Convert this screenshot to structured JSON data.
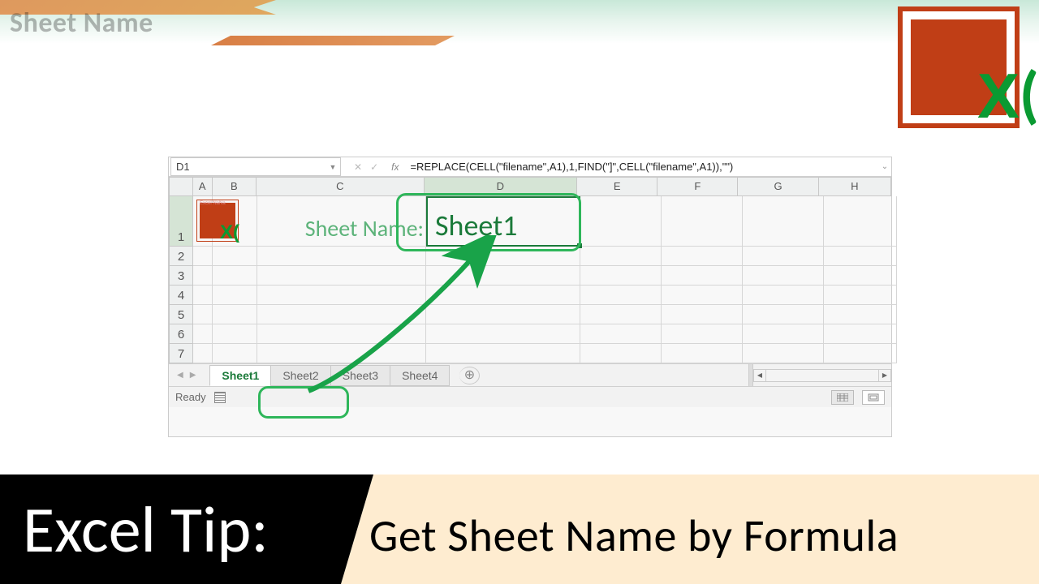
{
  "header": {
    "title": "Sheet Name"
  },
  "logo": {
    "glyph_x": "X",
    "glyph_paren": "("
  },
  "excel": {
    "name_box": "D1",
    "fx_label": "fx",
    "formula": "=REPLACE(CELL(\"filename\",A1),1,FIND(\"]\",CELL(\"filename\",A1)),\"\")",
    "columns": [
      "A",
      "B",
      "C",
      "D",
      "E",
      "F",
      "G",
      "H"
    ],
    "rows": [
      "1",
      "2",
      "3",
      "4",
      "5",
      "6",
      "7"
    ],
    "label_c1": "Sheet Name:",
    "value_d1": "Sheet1",
    "sheet_image_caption": "Excel NaNa",
    "tabs": [
      "Sheet1",
      "Sheet2",
      "Sheet3",
      "Sheet4"
    ],
    "active_tab": 0,
    "status": "Ready"
  },
  "banner": {
    "left": "Excel Tip:",
    "right": "Get Sheet Name by Formula"
  }
}
